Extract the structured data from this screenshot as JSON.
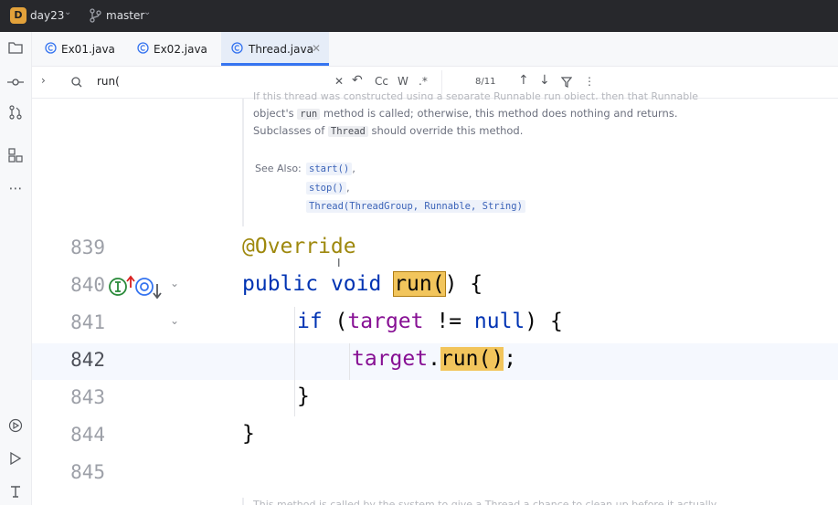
{
  "titlebar": {
    "project_badge": "D",
    "project_name": "day23",
    "branch": "master"
  },
  "tabs": [
    {
      "label": "Ex01.java",
      "icon": "java-class-icon"
    },
    {
      "label": "Ex02.java",
      "icon": "java-class-icon"
    },
    {
      "label": "Thread.java",
      "icon": "java-class-icon",
      "active": true
    }
  ],
  "find": {
    "query": "run(",
    "case_label": "Cc",
    "word_label": "W",
    "regex_label": ".*",
    "match_count": "8/11"
  },
  "doc": {
    "line0": "If this thread was constructed using a separate Runnable run object, then that Runnable",
    "line1_a": "object's",
    "line1_code": "run",
    "line1_b": "method is called; otherwise, this method does nothing and returns.",
    "line2_a": "Subclasses of",
    "line2_code": "Thread",
    "line2_b": "should override this method.",
    "see_also_label": "See Also:",
    "links": [
      "start()",
      "stop()",
      "Thread(ThreadGroup, Runnable, String)"
    ],
    "footer": "This method is called by the system to give a Thread a chance to clean up before it actually"
  },
  "code": {
    "lines": [
      {
        "num": "839",
        "text": "@Override"
      },
      {
        "num": "840",
        "text": "public void run() {"
      },
      {
        "num": "841",
        "text": "if (target != null) {"
      },
      {
        "num": "842",
        "text": "target.run();"
      },
      {
        "num": "843",
        "text": "}"
      },
      {
        "num": "844",
        "text": "}"
      },
      {
        "num": "845",
        "text": ""
      }
    ],
    "kw_public": "public",
    "kw_void": "void",
    "match_run": "run(",
    "after_run": ") {",
    "kw_if": "if",
    "paren_open": " (",
    "fld_target": "target",
    "neq": " != ",
    "kw_null": "null",
    "close_brace_open": ") {",
    "dot": ".",
    "call_run": "run()",
    "semicolon": ";",
    "brace": "}"
  },
  "colors": {
    "keyword": "#0033b3",
    "annotation": "#9e880d",
    "field": "#871094",
    "match_highlight": "#f2c55c",
    "accent": "#3574f0"
  }
}
